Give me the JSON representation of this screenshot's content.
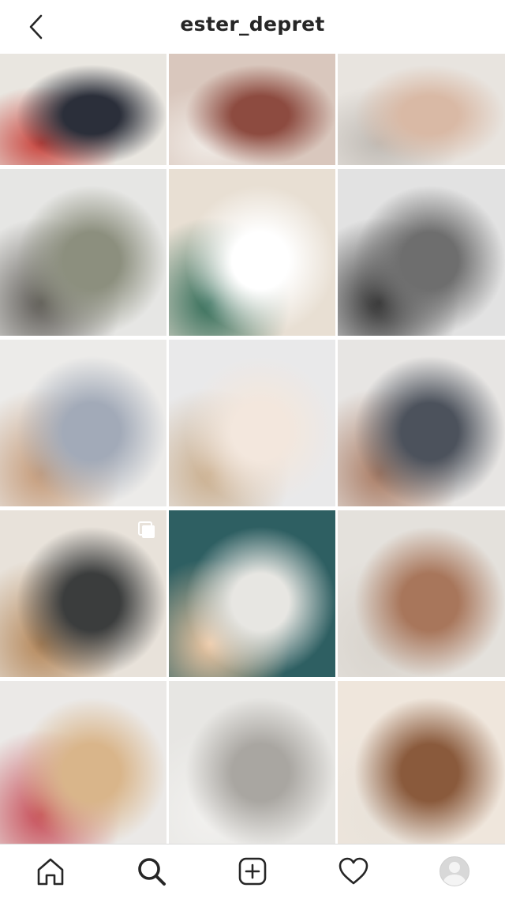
{
  "header": {
    "username": "ester_depret",
    "back_icon": "chevron-left-icon"
  },
  "posts": [
    {
      "name": "post-books-shelf",
      "colors": [
        "#e9e6e0",
        "#2b2f3a",
        "#c8413a"
      ]
    },
    {
      "name": "post-mother-baby-rug",
      "colors": [
        "#d9c7bd",
        "#8d4b40",
        "#f1ece7"
      ]
    },
    {
      "name": "post-baby-sleeping-blanket",
      "colors": [
        "#e8e4df",
        "#d9b9a5",
        "#bfbab4"
      ]
    },
    {
      "name": "post-father-changing-table",
      "colors": [
        "#e6e6e4",
        "#8c8f7e",
        "#5d5a55"
      ]
    },
    {
      "name": "post-baby-yawning",
      "colors": [
        "#e8dfd3",
        "#ffffff",
        "#2f6a55"
      ]
    },
    {
      "name": "post-mother-holding-baby-bw",
      "colors": [
        "#e2e2e2",
        "#6e6e6e",
        "#2f2f2f"
      ]
    },
    {
      "name": "post-mother-holding-newborn",
      "colors": [
        "#ecebe9",
        "#a2aab8",
        "#c49a78"
      ]
    },
    {
      "name": "post-girl-and-baby-lying",
      "colors": [
        "#e9e9ea",
        "#f3e7dd",
        "#c9ad8c"
      ]
    },
    {
      "name": "post-father-baby-sleeping",
      "colors": [
        "#e7e5e3",
        "#4c525c",
        "#a97b63"
      ]
    },
    {
      "name": "post-name-chalkboard",
      "colors": [
        "#e8e2da",
        "#3b3d3d",
        "#b4875a"
      ],
      "multi": true
    },
    {
      "name": "post-siblings-with-baby",
      "colors": [
        "#2e5f62",
        "#e7e6e2",
        "#f0c9a4"
      ]
    },
    {
      "name": "post-baby-on-scale",
      "colors": [
        "#e4e1dc",
        "#a8765b",
        "#d8d3cc"
      ]
    },
    {
      "name": "post-girl-with-lollipops",
      "colors": [
        "#ebe9e7",
        "#d9b58a",
        "#c64a55"
      ]
    },
    {
      "name": "post-baby-knit-blanket",
      "colors": [
        "#e7e6e3",
        "#a9a6a1",
        "#f2f1ef"
      ]
    },
    {
      "name": "post-baby-patterned-sheet",
      "colors": [
        "#efe6dc",
        "#8a5a3c",
        "#e8e2da"
      ]
    }
  ],
  "tabbar": {
    "items": [
      {
        "name": "home-icon"
      },
      {
        "name": "search-icon"
      },
      {
        "name": "new-post-icon"
      },
      {
        "name": "activity-heart-icon"
      },
      {
        "name": "profile-avatar-icon"
      }
    ]
  },
  "colors": {
    "text": "#262626",
    "divider": "#dbdbdb",
    "background": "#ffffff"
  }
}
